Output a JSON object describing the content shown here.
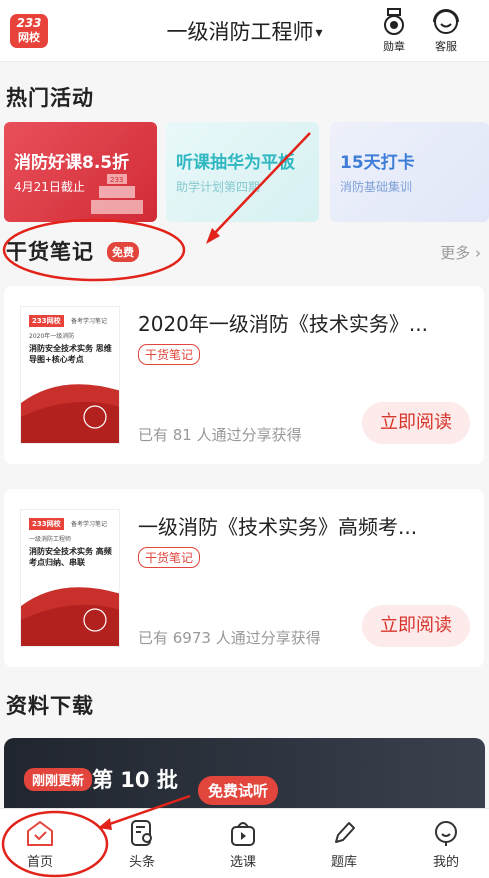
{
  "header": {
    "logo_top": "233",
    "logo_bottom": "网校",
    "title": "一级消防工程师",
    "caret": "▾",
    "badge_label": "勋章",
    "service_label": "客服"
  },
  "hot": {
    "title": "热门活动",
    "promos": [
      {
        "title": "消防好课8.5折",
        "sub": "4月21日截止"
      },
      {
        "title": "听课抽华为平板",
        "sub": "助学计划第四期"
      },
      {
        "title": "15天打卡",
        "sub": "消防基础集训"
      }
    ]
  },
  "notes": {
    "title": "干货笔记",
    "free_badge": "免费",
    "more": "更多 ›",
    "items": [
      {
        "title": "2020年一级消防《技术实务》...",
        "tag": "干货笔记",
        "shares": "已有 81 人通过分享获得",
        "button": "立即阅读",
        "cover_logo": "233网校",
        "cover_tag": "备考学习笔记",
        "cover_sub": "2020年一级消防",
        "cover_heading": "消防安全技术实务 思维导图+核心考点"
      },
      {
        "title": "一级消防《技术实务》高频考...",
        "tag": "干货笔记",
        "shares": "已有 6973 人通过分享获得",
        "button": "立即阅读",
        "cover_logo": "233网校",
        "cover_tag": "备考学习笔记",
        "cover_sub": "一级消防工程师",
        "cover_heading": "消防安全技术实务 高频考点归纳、串联"
      }
    ]
  },
  "downloads": {
    "title": "资料下载",
    "new_badge": "刚刚更新",
    "batch": "第 10 批"
  },
  "tabbar": {
    "trial": "免费试听",
    "tabs": [
      {
        "label": "首页",
        "icon": "home-icon"
      },
      {
        "label": "头条",
        "icon": "news-icon"
      },
      {
        "label": "选课",
        "icon": "course-bag-icon"
      },
      {
        "label": "题库",
        "icon": "pencil-icon"
      },
      {
        "label": "我的",
        "icon": "profile-icon"
      }
    ]
  },
  "colors": {
    "brand_red": "#e2453c",
    "promo_teal": "#2fb8c2",
    "promo_blue": "#3e7ed6"
  }
}
